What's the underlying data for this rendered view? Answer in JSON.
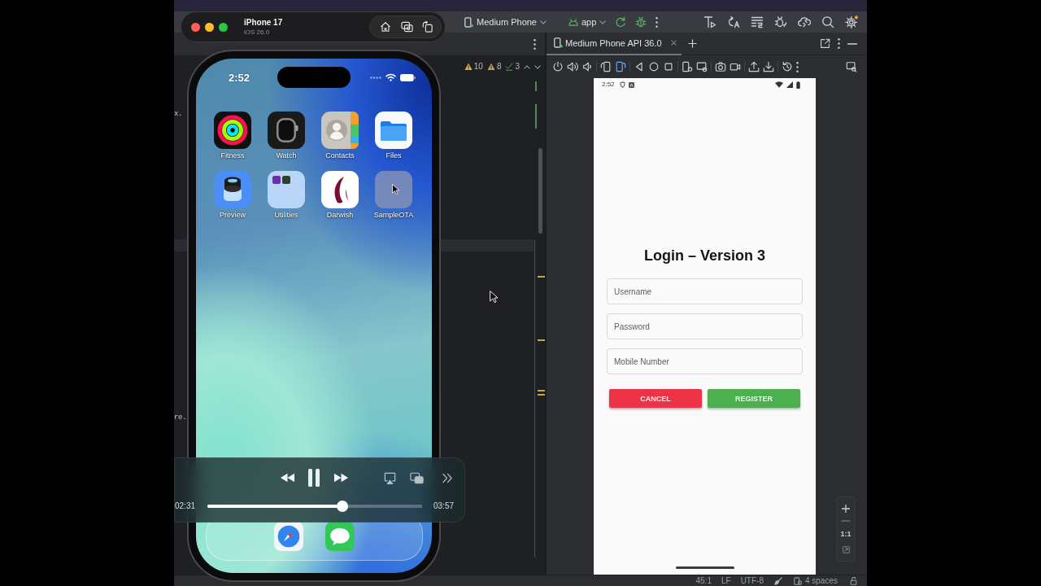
{
  "ide_toolbar": {
    "device_selector": "Medium Phone",
    "run_configuration": "app"
  },
  "editor": {
    "inspections": [
      {
        "kind": "warning",
        "count": "10"
      },
      {
        "kind": "weak_warning",
        "count": "8"
      },
      {
        "kind": "ok",
        "count": "3"
      }
    ],
    "code_fragments": [
      "x.",
      "re."
    ]
  },
  "simulator": {
    "device": "iPhone 17",
    "os": "iOS 26.0",
    "status_time": "2:52",
    "apps": [
      {
        "name": "Fitness",
        "kind": "fitness"
      },
      {
        "name": "Watch",
        "kind": "watch"
      },
      {
        "name": "Contacts",
        "kind": "contacts"
      },
      {
        "name": "Files",
        "kind": "files"
      },
      {
        "name": "Preview",
        "kind": "preview"
      },
      {
        "name": "Utilities",
        "kind": "folder"
      },
      {
        "name": "Darwish",
        "kind": "darwish"
      },
      {
        "name": "SampleOTA",
        "kind": "blank"
      }
    ],
    "dock": [
      {
        "kind": "safari"
      },
      {
        "kind": "messages"
      }
    ]
  },
  "media_player": {
    "playing": true,
    "elapsed": "02:31",
    "level": 0.63,
    "duration": "03:57"
  },
  "emulator": {
    "tabs": [
      {
        "label": "Medium Phone API 36.0",
        "selected": true
      }
    ],
    "screen": {
      "status_time": "2:52",
      "title": "Login – Version 3",
      "fields": [
        {
          "placeholder": "Username"
        },
        {
          "placeholder": "Password"
        },
        {
          "placeholder": "Mobile Number"
        }
      ],
      "buttons": [
        {
          "label": "CANCEL",
          "kind": "cancel"
        },
        {
          "label": "REGISTER",
          "kind": "register"
        }
      ]
    },
    "zoom_reset": "1:1"
  },
  "status_bar": {
    "caret_position": "45:1",
    "line_separator": "LF",
    "encoding": "UTF-8",
    "indent": "4 spaces"
  }
}
